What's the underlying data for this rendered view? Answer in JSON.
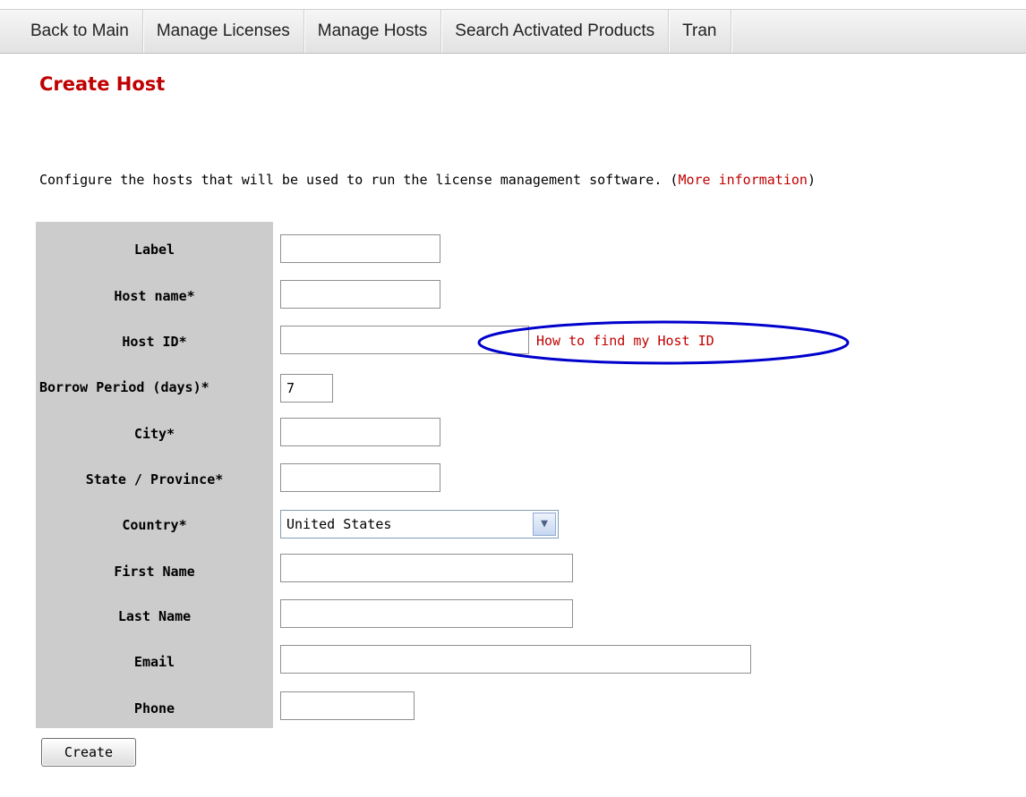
{
  "nav": {
    "items": [
      {
        "label": "Back to Main"
      },
      {
        "label": "Manage Licenses"
      },
      {
        "label": "Manage Hosts"
      },
      {
        "label": "Search Activated Products"
      },
      {
        "label": "Tran"
      }
    ]
  },
  "page": {
    "title": "Create Host",
    "intro_text": "Configure the hosts that will be used to run the license management software. (",
    "intro_link": "More information",
    "intro_close": ")"
  },
  "form": {
    "label_label": "Label",
    "label_value": "",
    "hostname_label": "Host name*",
    "hostname_value": "",
    "hostid_label": "Host ID*",
    "hostid_value": "",
    "hostid_help_link": "How to find my Host ID",
    "borrow_label": "Borrow Period (days)*",
    "borrow_value": "7",
    "city_label": "City*",
    "city_value": "",
    "state_label": "State / Province*",
    "state_value": "",
    "country_label": "Country*",
    "country_selected": "United States",
    "firstname_label": "First Name",
    "firstname_value": "",
    "lastname_label": "Last Name",
    "lastname_value": "",
    "email_label": "Email",
    "email_value": "",
    "phone_label": "Phone",
    "phone_value": "",
    "create_label": "Create"
  },
  "annotation": {
    "ellipse_color": "#0000cc"
  }
}
